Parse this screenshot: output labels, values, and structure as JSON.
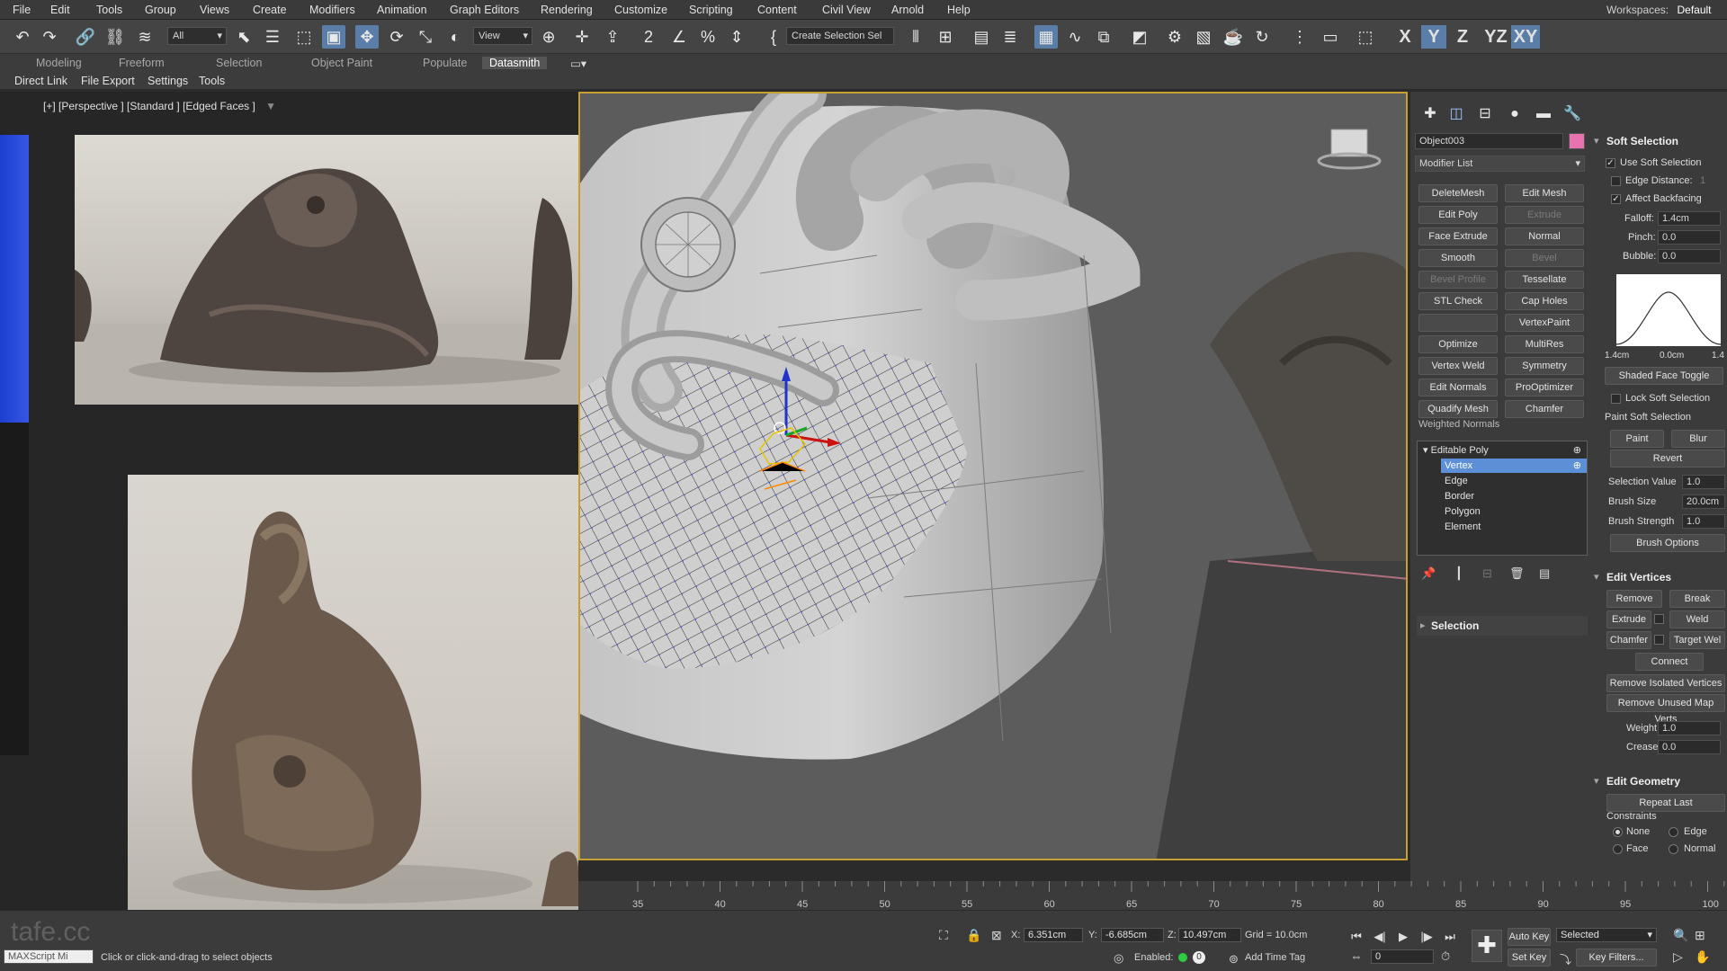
{
  "menubar": {
    "items": [
      "File",
      "Edit",
      "Tools",
      "Group",
      "Views",
      "Create",
      "Modifiers",
      "Animation",
      "Graph Editors",
      "Rendering",
      "Customize",
      "Scripting",
      "Content",
      "Civil View",
      "Arnold",
      "Help"
    ],
    "workspaces_label": "Workspaces:",
    "workspaces_value": "Default"
  },
  "toolbar": {
    "filter_value": "All",
    "refcoord_value": "View",
    "selection_set_placeholder": "Create Selection Sel",
    "axis_buttons": [
      "X",
      "Y",
      "Z",
      "YZ",
      "XY"
    ],
    "active_axis": "Y"
  },
  "ribbon": {
    "tabs": [
      "Modeling",
      "Freeform",
      "Selection",
      "Object Paint",
      "Populate",
      "Datasmith"
    ],
    "active_tab": "Datasmith",
    "secondary": [
      "Direct Link",
      "File Export",
      "Settings",
      "Tools"
    ]
  },
  "viewport": {
    "label": "[+] [Perspective ] [Standard ] [Edged Faces ]"
  },
  "command_panel": {
    "object_name": "Object003",
    "object_color": "#e873b0",
    "modifier_list": "Modifier List",
    "modifier_buttons": [
      {
        "label": "DeleteMesh",
        "enabled": true
      },
      {
        "label": "Edit Mesh",
        "enabled": true
      },
      {
        "label": "Edit Poly",
        "enabled": true
      },
      {
        "label": "Extrude",
        "enabled": false
      },
      {
        "label": "Face Extrude",
        "enabled": true
      },
      {
        "label": "Normal",
        "enabled": true
      },
      {
        "label": "Smooth",
        "enabled": true
      },
      {
        "label": "Bevel",
        "enabled": false
      },
      {
        "label": "Bevel Profile",
        "enabled": false
      },
      {
        "label": "Tessellate",
        "enabled": true
      },
      {
        "label": "STL Check",
        "enabled": true
      },
      {
        "label": "Cap Holes",
        "enabled": true
      },
      {
        "label": "",
        "enabled": true
      },
      {
        "label": "VertexPaint",
        "enabled": true
      },
      {
        "label": "Optimize",
        "enabled": true
      },
      {
        "label": "MultiRes",
        "enabled": true
      },
      {
        "label": "Vertex Weld",
        "enabled": true
      },
      {
        "label": "Symmetry",
        "enabled": true
      },
      {
        "label": "Edit Normals",
        "enabled": true
      },
      {
        "label": "ProOptimizer",
        "enabled": true
      },
      {
        "label": "Quadify Mesh",
        "enabled": true
      },
      {
        "label": "Chamfer",
        "enabled": true
      }
    ],
    "weighted_normals": "Weighted Normals",
    "stack": {
      "root": "Editable Poly",
      "items": [
        "Vertex",
        "Edge",
        "Border",
        "Polygon",
        "Element"
      ],
      "selected": "Vertex"
    },
    "selection_rollout": "Selection",
    "soft_selection": {
      "title": "Soft Selection",
      "use_soft_selection": "Use Soft Selection",
      "use_soft_selection_checked": true,
      "edge_distance": "Edge Distance:",
      "edge_distance_value": "1",
      "edge_distance_checked": false,
      "affect_backfacing": "Affect Backfacing",
      "affect_backfacing_checked": true,
      "falloff_label": "Falloff:",
      "falloff_value": "1.4cm",
      "pinch_label": "Pinch:",
      "pinch_value": "0.0",
      "bubble_label": "Bubble:",
      "bubble_value": "0.0",
      "curve_left": "1.4cm",
      "curve_mid": "0.0cm",
      "curve_right": "1.4",
      "shaded_face_toggle": "Shaded Face Toggle",
      "lock_soft_selection": "Lock Soft Selection",
      "paint_soft_selection": "Paint Soft Selection",
      "paint": "Paint",
      "blur": "Blur",
      "revert": "Revert",
      "selection_value_label": "Selection Value",
      "selection_value": "1.0",
      "brush_size_label": "Brush Size",
      "brush_size": "20.0cm",
      "brush_strength_label": "Brush Strength",
      "brush_strength": "1.0",
      "brush_options": "Brush Options"
    },
    "edit_vertices": {
      "title": "Edit Vertices",
      "remove": "Remove",
      "break": "Break",
      "extrude": "Extrude",
      "weld": "Weld",
      "chamfer": "Chamfer",
      "target_weld": "Target Wel",
      "connect": "Connect",
      "remove_isolated": "Remove Isolated Vertices",
      "remove_unused": "Remove Unused Map Verts",
      "weight_label": "Weight:",
      "weight_value": "1.0",
      "crease_label": "Crease:",
      "crease_value": "0.0"
    },
    "edit_geometry": {
      "title": "Edit Geometry",
      "repeat_last": "Repeat Last",
      "constraints": "Constraints",
      "none": "None",
      "edge": "Edge",
      "face": "Face",
      "normal": "Normal"
    }
  },
  "timeline": {
    "ticks": [
      "35",
      "40",
      "45",
      "50",
      "55",
      "60",
      "65",
      "70",
      "75",
      "80",
      "85",
      "90",
      "95",
      "100"
    ]
  },
  "statusbar": {
    "maxscript": "MAXScript Mi",
    "prompt": "Click or click-and-drag to select objects",
    "x_label": "X:",
    "x_value": "6.351cm",
    "y_label": "Y:",
    "y_value": "-6.685cm",
    "z_label": "Z:",
    "z_value": "10.497cm",
    "grid": "Grid = 10.0cm",
    "enabled_label": "Enabled:",
    "add_time_tag": "Add Time Tag",
    "auto_key": "Auto Key",
    "selected": "Selected",
    "set_key": "Set Key",
    "key_filters": "Key Filters...",
    "frame_value": "0",
    "watermark": "tafe.cc"
  },
  "colors": {
    "accent": "#5b7ea8",
    "selection_blue": "#5d8fd6",
    "viewport_border": "#c8a032"
  }
}
